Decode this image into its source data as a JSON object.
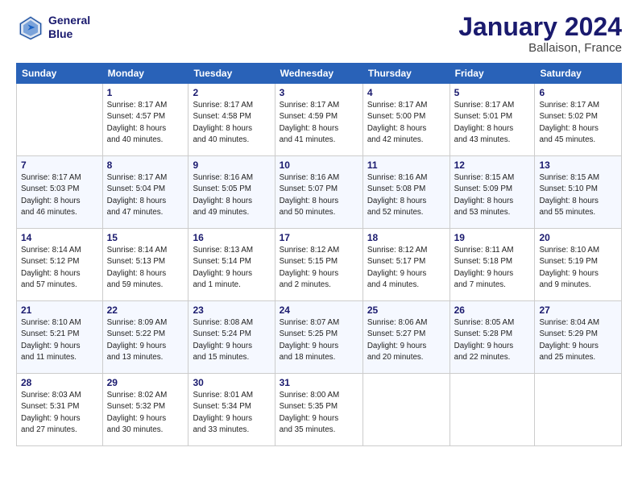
{
  "logo": {
    "line1": "General",
    "line2": "Blue"
  },
  "title": "January 2024",
  "subtitle": "Ballaison, France",
  "header_days": [
    "Sunday",
    "Monday",
    "Tuesday",
    "Wednesday",
    "Thursday",
    "Friday",
    "Saturday"
  ],
  "weeks": [
    [
      {
        "day": "",
        "info": ""
      },
      {
        "day": "1",
        "info": "Sunrise: 8:17 AM\nSunset: 4:57 PM\nDaylight: 8 hours\nand 40 minutes."
      },
      {
        "day": "2",
        "info": "Sunrise: 8:17 AM\nSunset: 4:58 PM\nDaylight: 8 hours\nand 40 minutes."
      },
      {
        "day": "3",
        "info": "Sunrise: 8:17 AM\nSunset: 4:59 PM\nDaylight: 8 hours\nand 41 minutes."
      },
      {
        "day": "4",
        "info": "Sunrise: 8:17 AM\nSunset: 5:00 PM\nDaylight: 8 hours\nand 42 minutes."
      },
      {
        "day": "5",
        "info": "Sunrise: 8:17 AM\nSunset: 5:01 PM\nDaylight: 8 hours\nand 43 minutes."
      },
      {
        "day": "6",
        "info": "Sunrise: 8:17 AM\nSunset: 5:02 PM\nDaylight: 8 hours\nand 45 minutes."
      }
    ],
    [
      {
        "day": "7",
        "info": "Sunrise: 8:17 AM\nSunset: 5:03 PM\nDaylight: 8 hours\nand 46 minutes."
      },
      {
        "day": "8",
        "info": "Sunrise: 8:17 AM\nSunset: 5:04 PM\nDaylight: 8 hours\nand 47 minutes."
      },
      {
        "day": "9",
        "info": "Sunrise: 8:16 AM\nSunset: 5:05 PM\nDaylight: 8 hours\nand 49 minutes."
      },
      {
        "day": "10",
        "info": "Sunrise: 8:16 AM\nSunset: 5:07 PM\nDaylight: 8 hours\nand 50 minutes."
      },
      {
        "day": "11",
        "info": "Sunrise: 8:16 AM\nSunset: 5:08 PM\nDaylight: 8 hours\nand 52 minutes."
      },
      {
        "day": "12",
        "info": "Sunrise: 8:15 AM\nSunset: 5:09 PM\nDaylight: 8 hours\nand 53 minutes."
      },
      {
        "day": "13",
        "info": "Sunrise: 8:15 AM\nSunset: 5:10 PM\nDaylight: 8 hours\nand 55 minutes."
      }
    ],
    [
      {
        "day": "14",
        "info": "Sunrise: 8:14 AM\nSunset: 5:12 PM\nDaylight: 8 hours\nand 57 minutes."
      },
      {
        "day": "15",
        "info": "Sunrise: 8:14 AM\nSunset: 5:13 PM\nDaylight: 8 hours\nand 59 minutes."
      },
      {
        "day": "16",
        "info": "Sunrise: 8:13 AM\nSunset: 5:14 PM\nDaylight: 9 hours\nand 1 minute."
      },
      {
        "day": "17",
        "info": "Sunrise: 8:12 AM\nSunset: 5:15 PM\nDaylight: 9 hours\nand 2 minutes."
      },
      {
        "day": "18",
        "info": "Sunrise: 8:12 AM\nSunset: 5:17 PM\nDaylight: 9 hours\nand 4 minutes."
      },
      {
        "day": "19",
        "info": "Sunrise: 8:11 AM\nSunset: 5:18 PM\nDaylight: 9 hours\nand 7 minutes."
      },
      {
        "day": "20",
        "info": "Sunrise: 8:10 AM\nSunset: 5:19 PM\nDaylight: 9 hours\nand 9 minutes."
      }
    ],
    [
      {
        "day": "21",
        "info": "Sunrise: 8:10 AM\nSunset: 5:21 PM\nDaylight: 9 hours\nand 11 minutes."
      },
      {
        "day": "22",
        "info": "Sunrise: 8:09 AM\nSunset: 5:22 PM\nDaylight: 9 hours\nand 13 minutes."
      },
      {
        "day": "23",
        "info": "Sunrise: 8:08 AM\nSunset: 5:24 PM\nDaylight: 9 hours\nand 15 minutes."
      },
      {
        "day": "24",
        "info": "Sunrise: 8:07 AM\nSunset: 5:25 PM\nDaylight: 9 hours\nand 18 minutes."
      },
      {
        "day": "25",
        "info": "Sunrise: 8:06 AM\nSunset: 5:27 PM\nDaylight: 9 hours\nand 20 minutes."
      },
      {
        "day": "26",
        "info": "Sunrise: 8:05 AM\nSunset: 5:28 PM\nDaylight: 9 hours\nand 22 minutes."
      },
      {
        "day": "27",
        "info": "Sunrise: 8:04 AM\nSunset: 5:29 PM\nDaylight: 9 hours\nand 25 minutes."
      }
    ],
    [
      {
        "day": "28",
        "info": "Sunrise: 8:03 AM\nSunset: 5:31 PM\nDaylight: 9 hours\nand 27 minutes."
      },
      {
        "day": "29",
        "info": "Sunrise: 8:02 AM\nSunset: 5:32 PM\nDaylight: 9 hours\nand 30 minutes."
      },
      {
        "day": "30",
        "info": "Sunrise: 8:01 AM\nSunset: 5:34 PM\nDaylight: 9 hours\nand 33 minutes."
      },
      {
        "day": "31",
        "info": "Sunrise: 8:00 AM\nSunset: 5:35 PM\nDaylight: 9 hours\nand 35 minutes."
      },
      {
        "day": "",
        "info": ""
      },
      {
        "day": "",
        "info": ""
      },
      {
        "day": "",
        "info": ""
      }
    ]
  ]
}
